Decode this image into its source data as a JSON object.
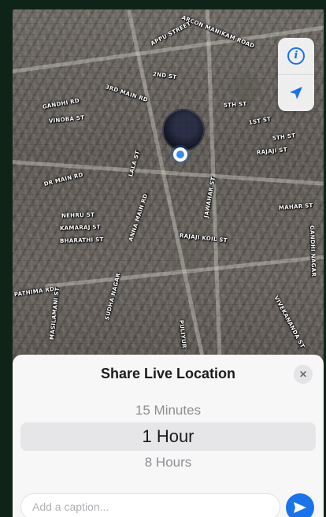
{
  "map": {
    "street_labels": [
      "ARCON MANIKAM ROAD",
      "APPU STREET",
      "2ND ST",
      "3RD MAIN RD",
      "GANDHI RD",
      "VINOBA ST",
      "1ST ST",
      "5TH ST",
      "5TH ST",
      "RAJAJI ST",
      "DR MAIN RD",
      "LALA ST",
      "ANNA MAIN RD",
      "NEHRU ST",
      "KAMARAJ ST",
      "MAHAR ST",
      "BHARATHI ST",
      "JAWAHAR ST",
      "PATHIMA RD",
      "RAJAJI KOIL ST",
      "GANDHI NAGAR",
      "SUDHA NAGAR",
      "PULIYUR",
      "VIVEKANANDA ST",
      "MASILAMANI ST"
    ],
    "controls": {
      "info_icon": "info-icon",
      "locate_icon": "location-arrow-icon"
    }
  },
  "sheet": {
    "title": "Share Live Location",
    "close_icon": "close-icon",
    "options": [
      "15 Minutes",
      "1 Hour",
      "8 Hours"
    ],
    "selected_option": "1 Hour",
    "caption_placeholder": "Add a caption...",
    "send_icon": "send-icon"
  },
  "colors": {
    "accent": "#1a73e8",
    "sheet_background": "#f7f7f7",
    "frame_background": "#0f2418"
  }
}
